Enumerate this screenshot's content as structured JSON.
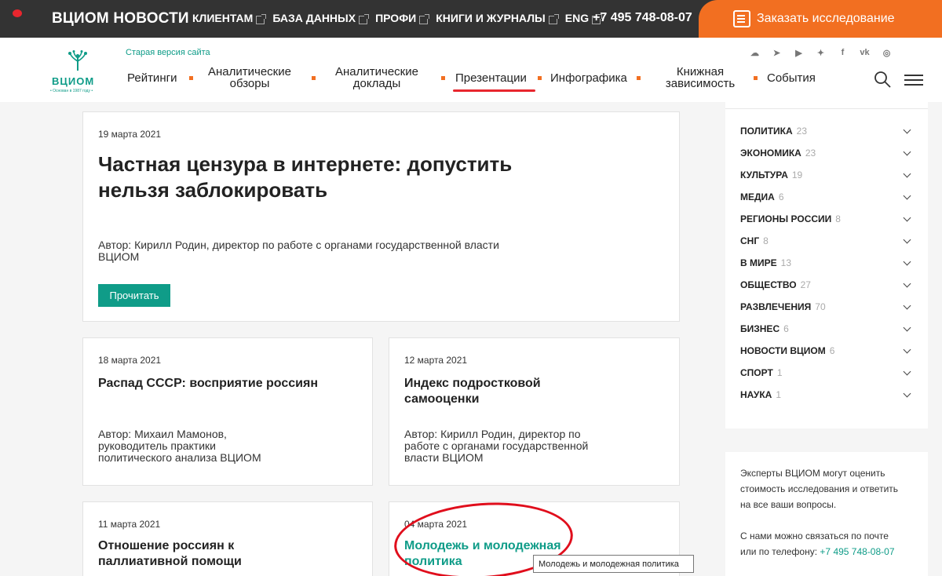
{
  "topbar": {
    "brand": "ВЦИОМ НОВОСТИ",
    "nav": [
      "КЛИЕНТАМ",
      "БАЗА ДАННЫХ",
      "ПРОФИ",
      "КНИГИ И ЖУРНАЛЫ",
      "ENG"
    ],
    "phone": "+7 495 748-08-07",
    "order_label": "Заказать исследование"
  },
  "header": {
    "logo_text": "ВЦИОМ",
    "logo_sub": "• Основан в 1987 году •",
    "old_site": "Старая версия сайта",
    "nav": [
      {
        "label": "Рейтинги"
      },
      {
        "label": "Аналитические обзоры"
      },
      {
        "label": "Аналитические доклады"
      },
      {
        "label": "Презентации"
      },
      {
        "label": "Инфографика"
      },
      {
        "label": "Книжная зависимость"
      },
      {
        "label": "События"
      }
    ],
    "active_nav": "Презентации",
    "social_icons": [
      "soundcloud-icon",
      "telegram-icon",
      "youtube-icon",
      "twitter-icon",
      "facebook-icon",
      "vk-icon",
      "instagram-icon"
    ]
  },
  "featured": {
    "date": "19 марта 2021",
    "title_line1": "Частная цензура в интернете: допустить",
    "title_line2": "нельзя заблокировать",
    "author_line1": "Автор: Кирилл Родин, директор по работе с органами государственной власти",
    "author_line2": "ВЦИОМ",
    "button": "Прочитать"
  },
  "cards": [
    {
      "date": "18 марта 2021",
      "title": [
        "Распад СССР: восприятие россиян"
      ],
      "author": [
        "Автор: Михаил Мамонов,",
        "руководитель практики",
        "политического анализа ВЦИОМ"
      ]
    },
    {
      "date": "12 марта 2021",
      "title": [
        "Индекс подростковой",
        "самооценки"
      ],
      "author": [
        "Автор: Кирилл Родин, директор по",
        "работе с органами государственной",
        "власти ВЦИОМ"
      ]
    },
    {
      "date": "11 марта 2021",
      "title": [
        "Отношение россиян к",
        "паллиативной помощи"
      ]
    },
    {
      "date": "04 марта 2021",
      "title": [
        "Молодежь и молодежная",
        "политика"
      ]
    }
  ],
  "tooltip": "Молодежь и молодежная политика",
  "sidebar": {
    "categories": [
      {
        "name": "ПОЛИТИКА",
        "count": "23"
      },
      {
        "name": "ЭКОНОМИКА",
        "count": "23"
      },
      {
        "name": "КУЛЬТУРА",
        "count": "19"
      },
      {
        "name": "МЕДИА",
        "count": "6"
      },
      {
        "name": "РЕГИОНЫ РОССИИ",
        "count": "8"
      },
      {
        "name": "СНГ",
        "count": "8"
      },
      {
        "name": "В МИРЕ",
        "count": "13"
      },
      {
        "name": "ОБЩЕСТВО",
        "count": "27"
      },
      {
        "name": "РАЗВЛЕЧЕНИЯ",
        "count": "70"
      },
      {
        "name": "БИЗНЕС",
        "count": "6"
      },
      {
        "name": "НОВОСТИ ВЦИОМ",
        "count": "6"
      },
      {
        "name": "СПОРТ",
        "count": "1"
      },
      {
        "name": "НАУКА",
        "count": "1"
      }
    ],
    "info_line1": "Эксперты ВЦИОМ могут оценить",
    "info_line2": "стоимость исследования и ответить",
    "info_line3": "на все ваши вопросы.",
    "info_line4": "С нами можно связаться по почте",
    "info_line5": "или по телефону:",
    "info_phone": "+7 495 748-08-07"
  },
  "colors": {
    "accent": "#0f9c88",
    "orange": "#f26f21",
    "topbar": "#333333",
    "highlight": "#e00e1c"
  }
}
